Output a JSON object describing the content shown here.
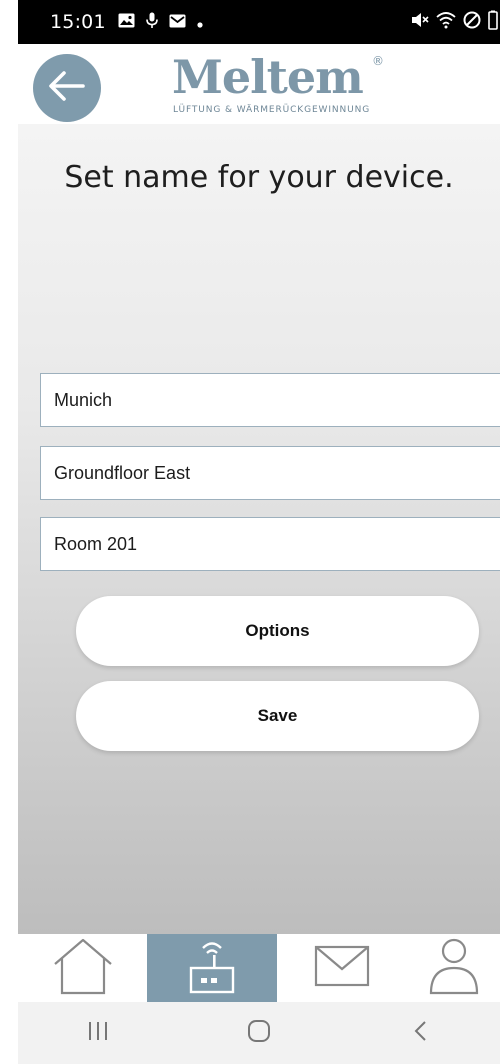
{
  "status_bar": {
    "time": "15:01",
    "icons_left": [
      "image-icon",
      "mic-icon",
      "mail-icon",
      "dot-icon"
    ],
    "icons_right": [
      "mute-icon",
      "wifi-icon",
      "blocked-icon",
      "battery-icon"
    ]
  },
  "header": {
    "back_icon": "arrow-left-icon",
    "logo_word": "Meltem",
    "logo_registered": "®",
    "logo_tagline": "LÜFTUNG & WÄRMERÜCKGEWINNUNG",
    "accent_color": "#7f9bac"
  },
  "main": {
    "title": "Set name for your device.",
    "fields": [
      {
        "value": "Munich"
      },
      {
        "value": "Groundfloor East"
      },
      {
        "value": "Room 201"
      }
    ],
    "buttons": {
      "options": "Options",
      "save": "Save"
    }
  },
  "bottom_nav": {
    "items": [
      {
        "icon": "home-icon",
        "active": false
      },
      {
        "icon": "router-icon",
        "active": true
      },
      {
        "icon": "mail-icon",
        "active": false
      },
      {
        "icon": "user-icon",
        "active": false
      }
    ]
  },
  "system_nav": {
    "icons": [
      "recent-apps-icon",
      "home-button-icon",
      "back-icon"
    ]
  }
}
